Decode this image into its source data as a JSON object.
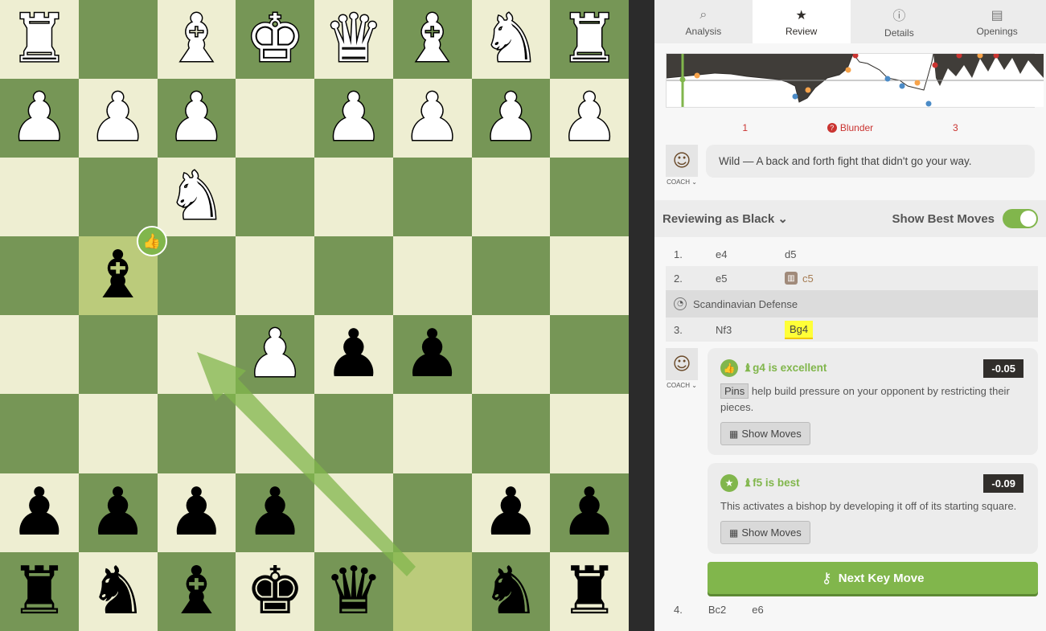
{
  "board": {
    "squares": [
      [
        "♜",
        "",
        "♝",
        "♚",
        "♛",
        "♝",
        "♞",
        "♜"
      ],
      [
        "♟",
        "♟",
        "♟",
        "",
        "♟",
        "♟",
        "♟",
        "♟"
      ],
      [
        "",
        "",
        "♞",
        "",
        "",
        "",
        "",
        ""
      ],
      [
        "",
        "♝",
        "",
        "",
        "",
        "",
        "",
        ""
      ],
      [
        "",
        "",
        "",
        "♟",
        "♟",
        "♟",
        "",
        ""
      ],
      [
        "",
        "",
        "",
        "",
        "",
        "",
        "",
        ""
      ],
      [
        "♟",
        "♟",
        "♟",
        "♟",
        "",
        "",
        "♟",
        "♟"
      ],
      [
        "♜",
        "♞",
        "♝",
        "♚",
        "♛",
        "",
        "♞",
        "♜"
      ]
    ],
    "colors": [
      [
        "w",
        "",
        "w",
        "w",
        "w",
        "w",
        "w",
        "w"
      ],
      [
        "w",
        "w",
        "w",
        "",
        "w",
        "w",
        "w",
        "w"
      ],
      [
        "",
        "",
        "w",
        "",
        "",
        "",
        "",
        ""
      ],
      [
        "",
        "b",
        "",
        "",
        "",
        "",
        "",
        ""
      ],
      [
        "",
        "",
        "",
        "w",
        "b",
        "b",
        "",
        ""
      ],
      [
        "",
        "",
        "",
        "",
        "",
        "",
        "",
        ""
      ],
      [
        "b",
        "b",
        "b",
        "b",
        "",
        "",
        "b",
        "b"
      ],
      [
        "b",
        "b",
        "b",
        "b",
        "b",
        "",
        "b",
        "b"
      ]
    ],
    "highlights": [
      [
        3,
        1
      ],
      [
        7,
        5
      ]
    ],
    "best_move_arrow_color": "#81b64c",
    "badge_icon": "thumbs-up-icon",
    "badge_glyph": "👍"
  },
  "tabs": [
    {
      "label": "Analysis",
      "icon": "analysis-icon",
      "glyph": "⌕"
    },
    {
      "label": "Review",
      "icon": "star-icon",
      "glyph": "★"
    },
    {
      "label": "Details",
      "icon": "info-icon",
      "glyph": "ⓘ"
    },
    {
      "label": "Openings",
      "icon": "book-stack-icon",
      "glyph": "▤"
    }
  ],
  "counts": {
    "left": "1",
    "blunder_label": "Blunder",
    "right": "3",
    "blunder_glyph": "?"
  },
  "coach": {
    "label": "COACH ⌄",
    "summary": "Wild — A back and forth fight that didn't go your way."
  },
  "reviewing": {
    "label": "Reviewing as Black ⌄",
    "show_best": "Show Best Moves"
  },
  "moves": {
    "row1": {
      "num": "1.",
      "white": "e4",
      "black": "d5"
    },
    "row2": {
      "num": "2.",
      "white": "e5",
      "black": "c5"
    },
    "opening": "Scandinavian Defense",
    "row3": {
      "num": "3.",
      "white": "Nf3",
      "black": "Bg4"
    },
    "row4": {
      "num": "4.",
      "white": "Bc2",
      "black": "e6"
    }
  },
  "cards": {
    "excellent": {
      "title": "♝g4  is excellent",
      "eval": "-0.05",
      "pins": "Pins",
      "text": "help build pressure on your opponent by restricting their pieces.",
      "button": "Show Moves"
    },
    "best": {
      "title": "♝f5  is best",
      "eval": "-0.09",
      "text": "This activates a bishop by developing it off of its starting square.",
      "button": "Show Moves"
    }
  },
  "next_button": "Next Key Move",
  "colors": {
    "accent": "#81b64c",
    "blunder": "#ca3431",
    "highlight_move": "#ffff38"
  }
}
